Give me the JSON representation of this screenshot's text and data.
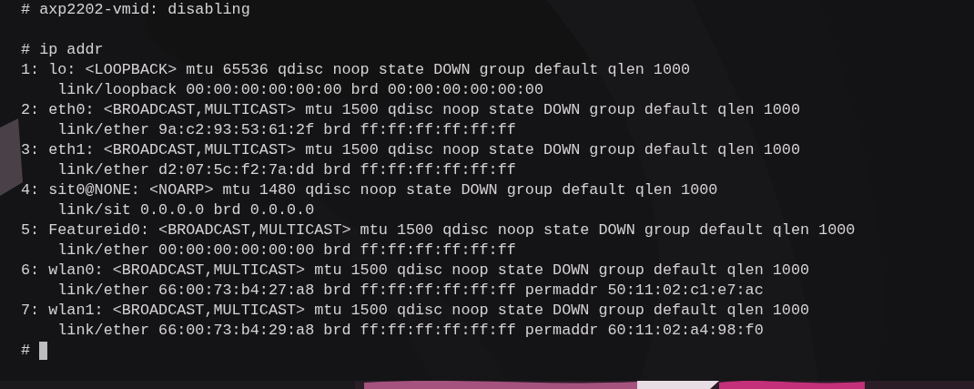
{
  "terminal": {
    "lines": [
      {
        "kind": "output",
        "text": "# axp2202-vmid: disabling"
      },
      {
        "kind": "blank"
      },
      {
        "kind": "output",
        "text": "# ip addr"
      },
      {
        "kind": "output",
        "text": "1: lo: <LOOPBACK> mtu 65536 qdisc noop state DOWN group default qlen 1000"
      },
      {
        "kind": "indented",
        "text": "link/loopback 00:00:00:00:00:00 brd 00:00:00:00:00:00"
      },
      {
        "kind": "output",
        "text": "2: eth0: <BROADCAST,MULTICAST> mtu 1500 qdisc noop state DOWN group default qlen 1000"
      },
      {
        "kind": "indented",
        "text": "link/ether 9a:c2:93:53:61:2f brd ff:ff:ff:ff:ff:ff"
      },
      {
        "kind": "output",
        "text": "3: eth1: <BROADCAST,MULTICAST> mtu 1500 qdisc noop state DOWN group default qlen 1000"
      },
      {
        "kind": "indented",
        "text": "link/ether d2:07:5c:f2:7a:dd brd ff:ff:ff:ff:ff:ff"
      },
      {
        "kind": "output",
        "text": "4: sit0@NONE: <NOARP> mtu 1480 qdisc noop state DOWN group default qlen 1000"
      },
      {
        "kind": "indented",
        "text": "link/sit 0.0.0.0 brd 0.0.0.0"
      },
      {
        "kind": "output",
        "text": "5: Featureid0: <BROADCAST,MULTICAST> mtu 1500 qdisc noop state DOWN group default qlen 1000"
      },
      {
        "kind": "indented",
        "text": "link/ether 00:00:00:00:00:00 brd ff:ff:ff:ff:ff:ff"
      },
      {
        "kind": "output",
        "text": "6: wlan0: <BROADCAST,MULTICAST> mtu 1500 qdisc noop state DOWN group default qlen 1000"
      },
      {
        "kind": "indented",
        "text": "link/ether 66:00:73:b4:27:a8 brd ff:ff:ff:ff:ff:ff permaddr 50:11:02:c1:e7:ac"
      },
      {
        "kind": "output",
        "text": "7: wlan1: <BROADCAST,MULTICAST> mtu 1500 qdisc noop state DOWN group default qlen 1000"
      },
      {
        "kind": "indented",
        "text": "link/ether 66:00:73:b4:29:a8 brd ff:ff:ff:ff:ff:ff permaddr 60:11:02:a4:98:f0"
      },
      {
        "kind": "prompt",
        "text": "#"
      }
    ]
  }
}
